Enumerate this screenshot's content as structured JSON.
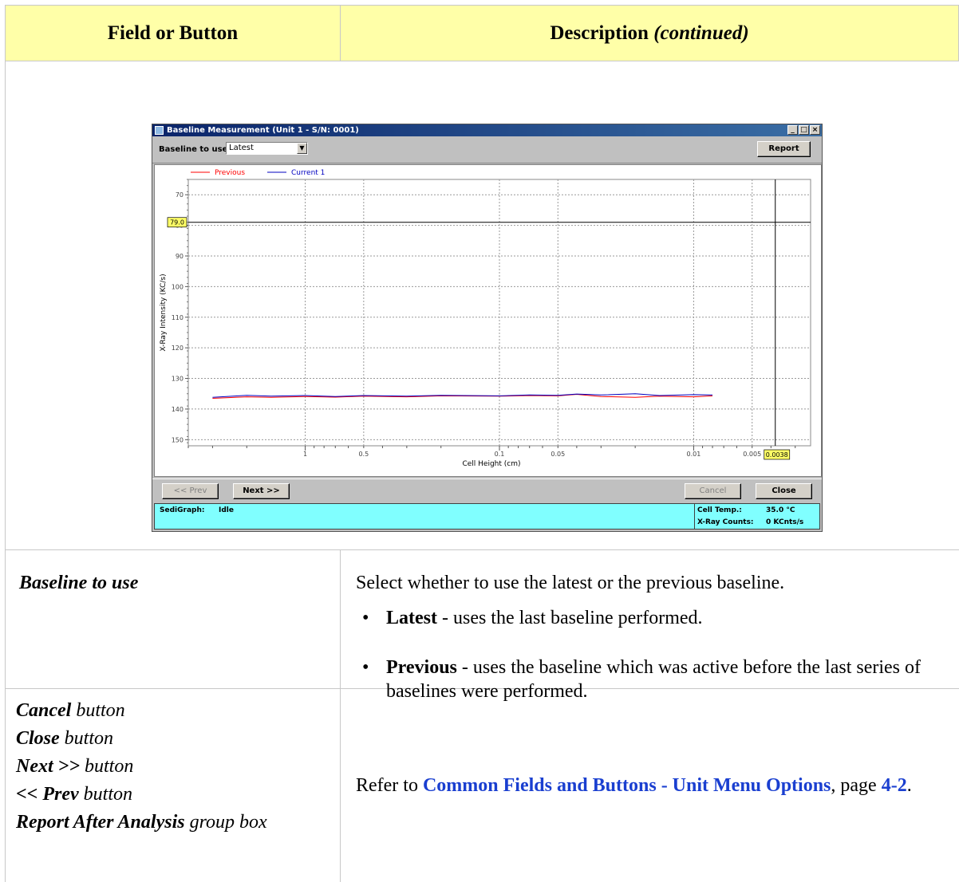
{
  "table": {
    "header_left": "Field or Button",
    "header_right_main": "Description ",
    "header_right_italic": "(continued)"
  },
  "window": {
    "title": "Baseline Measurement (Unit 1 - S/N: 0001)",
    "title_buttons": [
      "_",
      "□",
      "×"
    ],
    "baseline_label": "Baseline to use",
    "baseline_value": "Latest",
    "report_button": "Report",
    "prev_button": "<< Prev",
    "next_button": "Next >>",
    "cancel_button": "Cancel",
    "close_button": "Close",
    "status": {
      "device_label": "SediGraph:",
      "device_state": "Idle",
      "cell_temp_label": "Cell Temp.:",
      "cell_temp_value": "35.0 °C",
      "xray_label": "X-Ray Counts:",
      "xray_value": "0 KCnts/s"
    }
  },
  "chart_data": {
    "type": "line",
    "xlabel": "Cell Height (cm)",
    "ylabel": "X-Ray Intensity (KC/s)",
    "x_scale": "log",
    "x_reversed": true,
    "xlim": [
      4.0,
      0.0025
    ],
    "ylim": [
      152,
      65
    ],
    "y_reversed": true,
    "y_ticks": [
      70,
      80,
      90,
      100,
      110,
      120,
      130,
      140,
      150
    ],
    "x_tick_labels": [
      1,
      0.5,
      0.1,
      0.05,
      0.01,
      0.005
    ],
    "grid": true,
    "legend_position": "top-left",
    "markers": {
      "y_marker": "79.0",
      "x_marker": "0.0038"
    },
    "series": [
      {
        "name": "Previous",
        "color": "#ff0000",
        "x": [
          3.0,
          2.0,
          1.5,
          1.0,
          0.7,
          0.5,
          0.3,
          0.2,
          0.1,
          0.07,
          0.05,
          0.04,
          0.03,
          0.02,
          0.015,
          0.01,
          0.008
        ],
        "y": [
          136.5,
          136.0,
          136.2,
          135.9,
          136.1,
          135.8,
          136.0,
          135.7,
          135.8,
          135.6,
          135.7,
          135.2,
          135.9,
          136.2,
          135.8,
          136.0,
          135.7
        ]
      },
      {
        "name": "Current 1",
        "color": "#0000c0",
        "x": [
          3.0,
          2.0,
          1.5,
          1.0,
          0.7,
          0.5,
          0.3,
          0.2,
          0.1,
          0.07,
          0.05,
          0.04,
          0.03,
          0.02,
          0.015,
          0.01,
          0.008
        ],
        "y": [
          136.2,
          135.5,
          135.8,
          135.6,
          135.9,
          135.6,
          135.8,
          135.5,
          135.7,
          135.4,
          135.5,
          135.1,
          135.4,
          135.0,
          135.6,
          135.3,
          135.4
        ]
      }
    ]
  },
  "rows": [
    {
      "field": "Baseline to use",
      "intro": "Select whether to use the latest or the previous baseline.",
      "bullets": [
        {
          "term": "Latest",
          "text": " - uses the last baseline performed."
        },
        {
          "term": "Previous",
          "text": " - uses the baseline which was active before the last series of baselines were performed."
        }
      ]
    },
    {
      "fields": [
        {
          "bold": "Cancel",
          "rest": " button"
        },
        {
          "bold": "Close",
          "rest": " button"
        },
        {
          "bold": "Next >>",
          "rest": " button"
        },
        {
          "bold": "<< Prev",
          "rest": " button"
        },
        {
          "bold": "Report After Analysis",
          "rest": " group box"
        }
      ],
      "refer_prefix": "Refer to ",
      "refer_link": "Common Fields and Buttons - Unit Menu Options",
      "refer_mid": ", page ",
      "refer_page": "4-2",
      "refer_suffix": "."
    }
  ]
}
